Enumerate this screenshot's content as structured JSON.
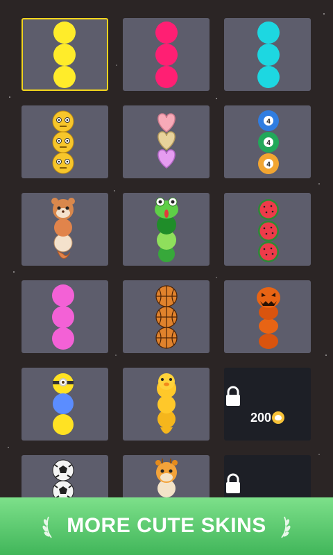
{
  "screen": "skin-selection",
  "skins": [
    {
      "row": 1,
      "col": 1,
      "skin": "yellow-balls",
      "color": "#ffec2a",
      "selected": true
    },
    {
      "row": 1,
      "col": 2,
      "skin": "pink-balls",
      "color": "#ff1f73"
    },
    {
      "row": 1,
      "col": 3,
      "skin": "cyan-balls",
      "color": "#1dd7e1"
    },
    {
      "row": 2,
      "col": 1,
      "skin": "emoji-faces",
      "color": "#f7c62b"
    },
    {
      "row": 2,
      "col": 2,
      "skin": "hearts",
      "colors": [
        "#f7aab8",
        "#e8d29b",
        "#e59cf0"
      ]
    },
    {
      "row": 2,
      "col": 3,
      "skin": "billiard-balls",
      "number": "4"
    },
    {
      "row": 3,
      "col": 1,
      "skin": "squirrel"
    },
    {
      "row": 3,
      "col": 2,
      "skin": "frog"
    },
    {
      "row": 3,
      "col": 3,
      "skin": "watermelon"
    },
    {
      "row": 4,
      "col": 1,
      "skin": "magenta-balls",
      "color": "#f361d6"
    },
    {
      "row": 4,
      "col": 2,
      "skin": "basketballs"
    },
    {
      "row": 4,
      "col": 3,
      "skin": "pumpkins"
    },
    {
      "row": 5,
      "col": 1,
      "skin": "minion",
      "colors": [
        "#ffe223",
        "#5b8dff",
        "#ffe223"
      ]
    },
    {
      "row": 5,
      "col": 2,
      "skin": "duck"
    },
    {
      "row": 5,
      "col": 3,
      "skin": "locked",
      "locked": true,
      "price": "200"
    },
    {
      "row": 6,
      "col": 1,
      "skin": "soccer-balls"
    },
    {
      "row": 6,
      "col": 2,
      "skin": "giraffe"
    },
    {
      "row": 6,
      "col": 3,
      "skin": "locked",
      "locked": true
    }
  ],
  "locked_price": "200",
  "banner": {
    "label": "MORE CUTE SKINS",
    "color": "#55c96c"
  },
  "icons": [
    "lock-icon",
    "coin-heart-icon",
    "laurel-icon"
  ]
}
